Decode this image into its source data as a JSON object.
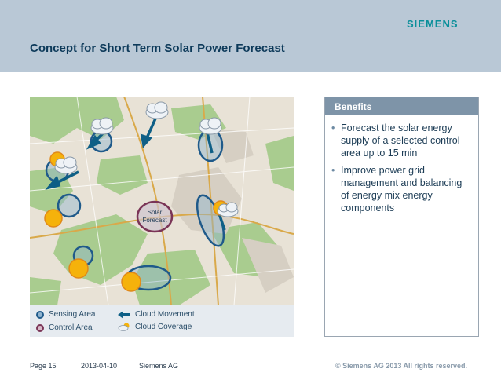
{
  "header": {
    "brand": "SIEMENS",
    "title": "Concept for Short Term Solar Power Forecast"
  },
  "map": {
    "center_label_line1": "Solar",
    "center_label_line2": "Forecast"
  },
  "legend": {
    "sensing_area": "Sensing Area",
    "control_area": "Control Area",
    "cloud_movement": "Cloud Movement",
    "cloud_coverage": "Cloud Coverage"
  },
  "benefits": {
    "heading": "Benefits",
    "items": [
      "Forecast the solar energy supply of a selected control area up to 15 min",
      "Improve power grid management and balancing of energy mix energy components"
    ]
  },
  "footer": {
    "page": "Page 15",
    "date": "2013-04-10",
    "company": "Siemens AG",
    "copyright": "© Siemens AG 2013 All rights reserved."
  },
  "colors": {
    "header_bg": "#b9c8d6",
    "brand": "#0a8f9a",
    "title": "#0d3a5a",
    "benefits_head": "#7e94a8",
    "sensing_ring": "#1f5a8a",
    "control_ring": "#7a3456",
    "arrow": "#0e5f86"
  }
}
